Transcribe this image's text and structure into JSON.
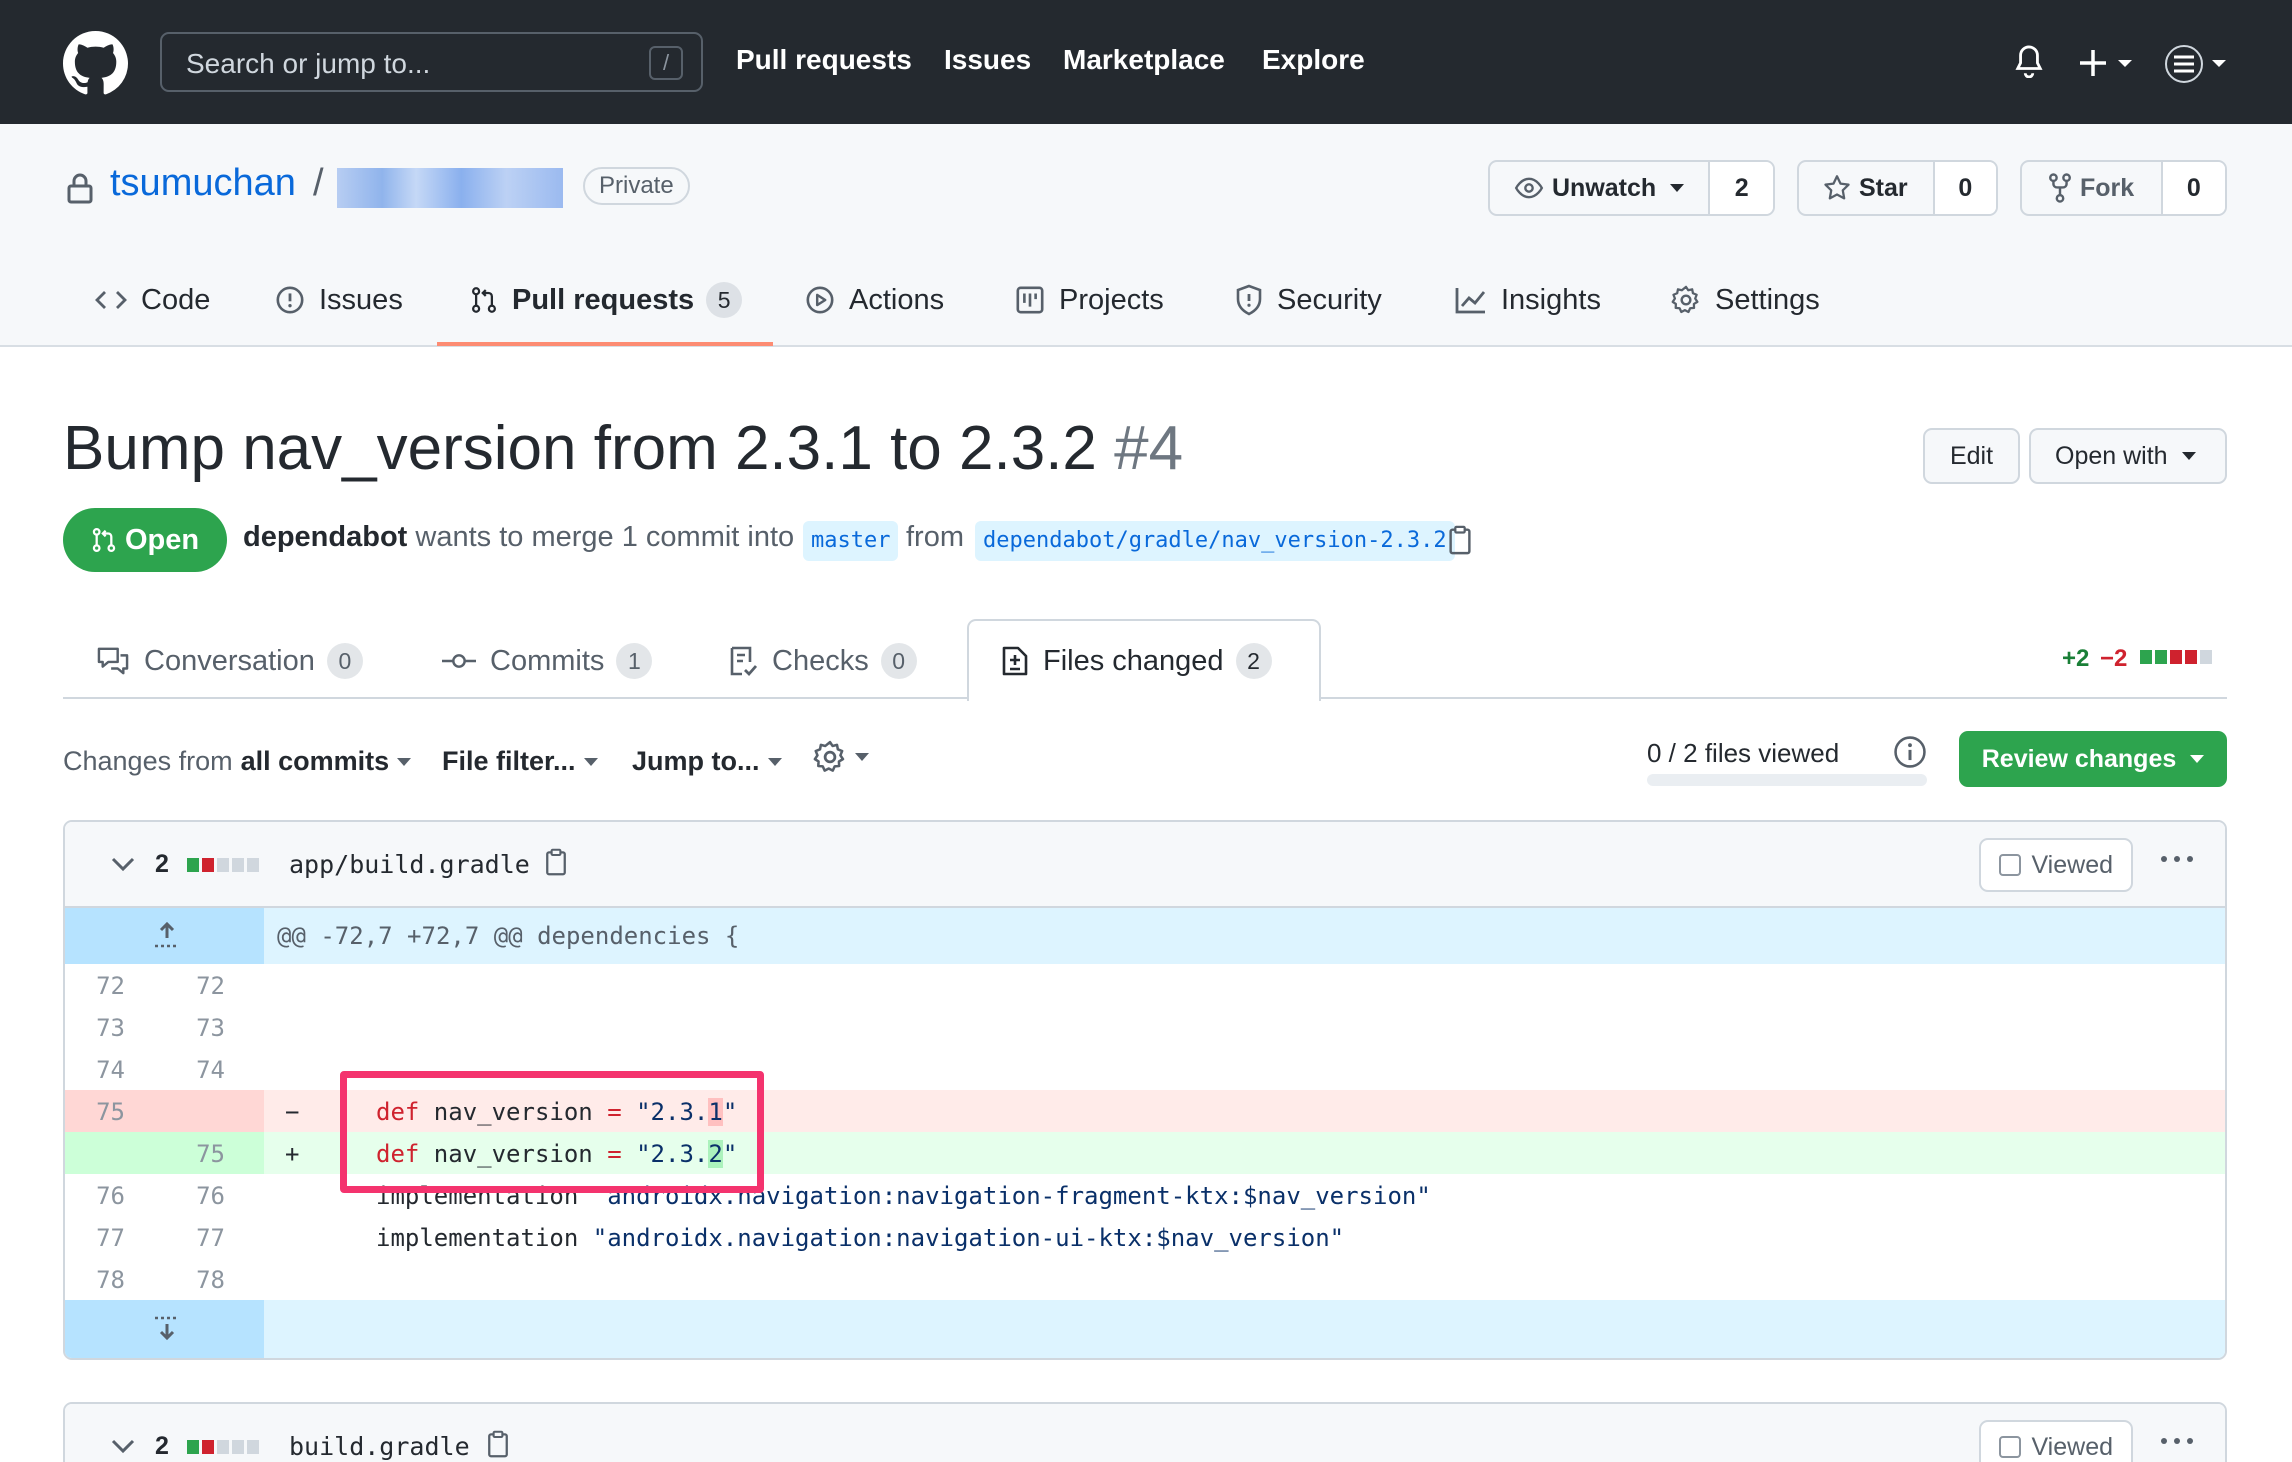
{
  "header": {
    "search_placeholder": "Search or jump to...",
    "search_shortcut": "/",
    "nav": [
      "Pull requests",
      "Issues",
      "Marketplace",
      "Explore"
    ]
  },
  "repo": {
    "owner": "tsumuchan",
    "separator": "/",
    "visibility": "Private",
    "unwatch_label": "Unwatch",
    "watch_count": "2",
    "star_label": "Star",
    "star_count": "0",
    "fork_label": "Fork",
    "fork_count": "0",
    "tabs": [
      {
        "label": "Code"
      },
      {
        "label": "Issues"
      },
      {
        "label": "Pull requests",
        "count": "5"
      },
      {
        "label": "Actions"
      },
      {
        "label": "Projects"
      },
      {
        "label": "Security"
      },
      {
        "label": "Insights"
      },
      {
        "label": "Settings"
      }
    ]
  },
  "pr": {
    "title": "Bump nav_version from 2.3.1 to 2.3.2",
    "number": "#4",
    "edit_label": "Edit",
    "open_with_label": "Open with",
    "state": "Open",
    "author": "dependabot",
    "merge_text": "wants to merge 1 commit into",
    "base_branch": "master",
    "from_text": "from",
    "head_branch": "dependabot/gradle/nav_version-2.3.2",
    "tabs": [
      {
        "label": "Conversation",
        "count": "0"
      },
      {
        "label": "Commits",
        "count": "1"
      },
      {
        "label": "Checks",
        "count": "0"
      },
      {
        "label": "Files changed",
        "count": "2"
      }
    ],
    "additions": "+2",
    "deletions": "−2"
  },
  "toolbar": {
    "changes_from": "Changes from",
    "all_commits": "all commits",
    "file_filter": "File filter...",
    "jump_to": "Jump to...",
    "files_viewed": "0 / 2 files viewed",
    "review_label": "Review changes"
  },
  "files": [
    {
      "changes": "2",
      "name": "app/build.gradle",
      "viewed_label": "Viewed",
      "hunk": "@@ -72,7 +72,7 @@ dependencies {",
      "lines": [
        {
          "old": "72",
          "new": "72",
          "marker": "",
          "code": ""
        },
        {
          "old": "73",
          "new": "73",
          "marker": "",
          "code": ""
        },
        {
          "old": "74",
          "new": "74",
          "marker": "",
          "code": ""
        },
        {
          "old": "75",
          "new": "",
          "marker": "−",
          "kw": "def",
          "mid": " nav_version ",
          "op": "=",
          "pre": " \"2.3.",
          "hl": "1",
          "post": "\""
        },
        {
          "old": "",
          "new": "75",
          "marker": "+",
          "kw": "def",
          "mid": " nav_version ",
          "op": "=",
          "pre": " \"2.3.",
          "hl": "2",
          "post": "\""
        },
        {
          "old": "76",
          "new": "76",
          "marker": "",
          "code_a": "implementation ",
          "code_b": "\"androidx.navigation:navigation-fragment-ktx:$nav_version\""
        },
        {
          "old": "77",
          "new": "77",
          "marker": "",
          "code_a": "implementation ",
          "code_b": "\"androidx.navigation:navigation-ui-ktx:$nav_version\""
        },
        {
          "old": "78",
          "new": "78",
          "marker": "",
          "code": ""
        }
      ]
    },
    {
      "changes": "2",
      "name": "build.gradle",
      "viewed_label": "Viewed"
    }
  ],
  "colors": {
    "header_bg": "#24292f",
    "accent_blue": "#0969da",
    "open_green": "#2da44e",
    "highlight_pink": "#f4336e"
  }
}
